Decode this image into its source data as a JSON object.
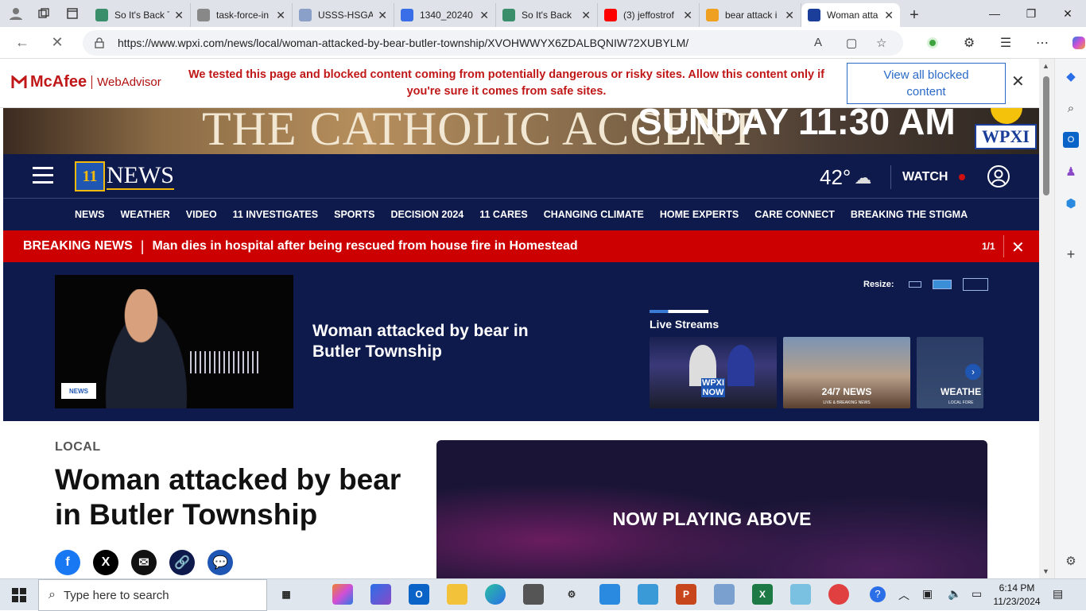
{
  "browser": {
    "tabs": [
      {
        "title": "So It's Back T",
        "color": "#3a8f6a"
      },
      {
        "title": "task-force-in",
        "color": "#888888"
      },
      {
        "title": "USSS-HSGAI",
        "color": "#8aa0c8"
      },
      {
        "title": "1340_20240",
        "color": "#3a6ee8"
      },
      {
        "title": "So It's Back",
        "color": "#3a8f6a"
      },
      {
        "title": "(3) jeffostrof",
        "color": "#ff0000"
      },
      {
        "title": "bear attack i",
        "color": "#f0a020"
      },
      {
        "title": "Woman atta",
        "color": "#1a3e9a",
        "active": true
      }
    ],
    "url": "https://www.wpxi.com/news/local/woman-attacked-by-bear-butler-township/XVOHWWYX6ZDALBQNIW72XUBYLM/"
  },
  "mcafee": {
    "brand": "McAfee",
    "product": "WebAdvisor",
    "message": "We tested this page and blocked content coming from potentially dangerous or risky sites. Allow this content only if you're sure it comes from safe sites.",
    "button": "View all blocked content"
  },
  "banner": {
    "left_text": "THE CATHOLIC ACCENT",
    "right_text": "SUNDAY 11:30 AM",
    "logo": "WPXI"
  },
  "site": {
    "logo_num": "11",
    "logo_text": "NEWS",
    "temperature": "42°",
    "watch": "WATCH",
    "nav": [
      "NEWS",
      "WEATHER",
      "VIDEO",
      "11 INVESTIGATES",
      "SPORTS",
      "DECISION 2024",
      "11 CARES",
      "CHANGING CLIMATE",
      "HOME EXPERTS",
      "CARE CONNECT",
      "BREAKING THE STIGMA"
    ]
  },
  "breaking": {
    "label": "BREAKING NEWS",
    "separator": "|",
    "headline": "Man dies in hospital after being rescued from house fire in Homestead",
    "count": "1/1"
  },
  "video": {
    "title": "Woman attacked by bear in Butler Township",
    "watermark": "NEWS",
    "resize_label": "Resize:",
    "live_label": "Live Streams",
    "streams": [
      {
        "caption": "WPXI NOW",
        "sub": ""
      },
      {
        "caption": "24/7 NEWS",
        "sub": "LIVE & BREAKING NEWS"
      },
      {
        "caption": "WEATHE",
        "sub": "LOCAL FORE"
      }
    ]
  },
  "article": {
    "section": "LOCAL",
    "title": "Woman attacked by bear in Butler Township",
    "share": [
      {
        "name": "facebook",
        "glyph": "f",
        "color": "#1877f2"
      },
      {
        "name": "x",
        "glyph": "X",
        "color": "#000000"
      },
      {
        "name": "email",
        "glyph": "✉",
        "color": "#111111"
      },
      {
        "name": "link",
        "glyph": "🔗",
        "color": "#0e1a4c"
      },
      {
        "name": "comment",
        "glyph": "💬",
        "color": "#1f56b4"
      }
    ],
    "player_text": "NOW PLAYING ABOVE"
  },
  "taskbar": {
    "search_placeholder": "Type here to search",
    "time": "6:14 PM",
    "date": "11/23/2024"
  }
}
